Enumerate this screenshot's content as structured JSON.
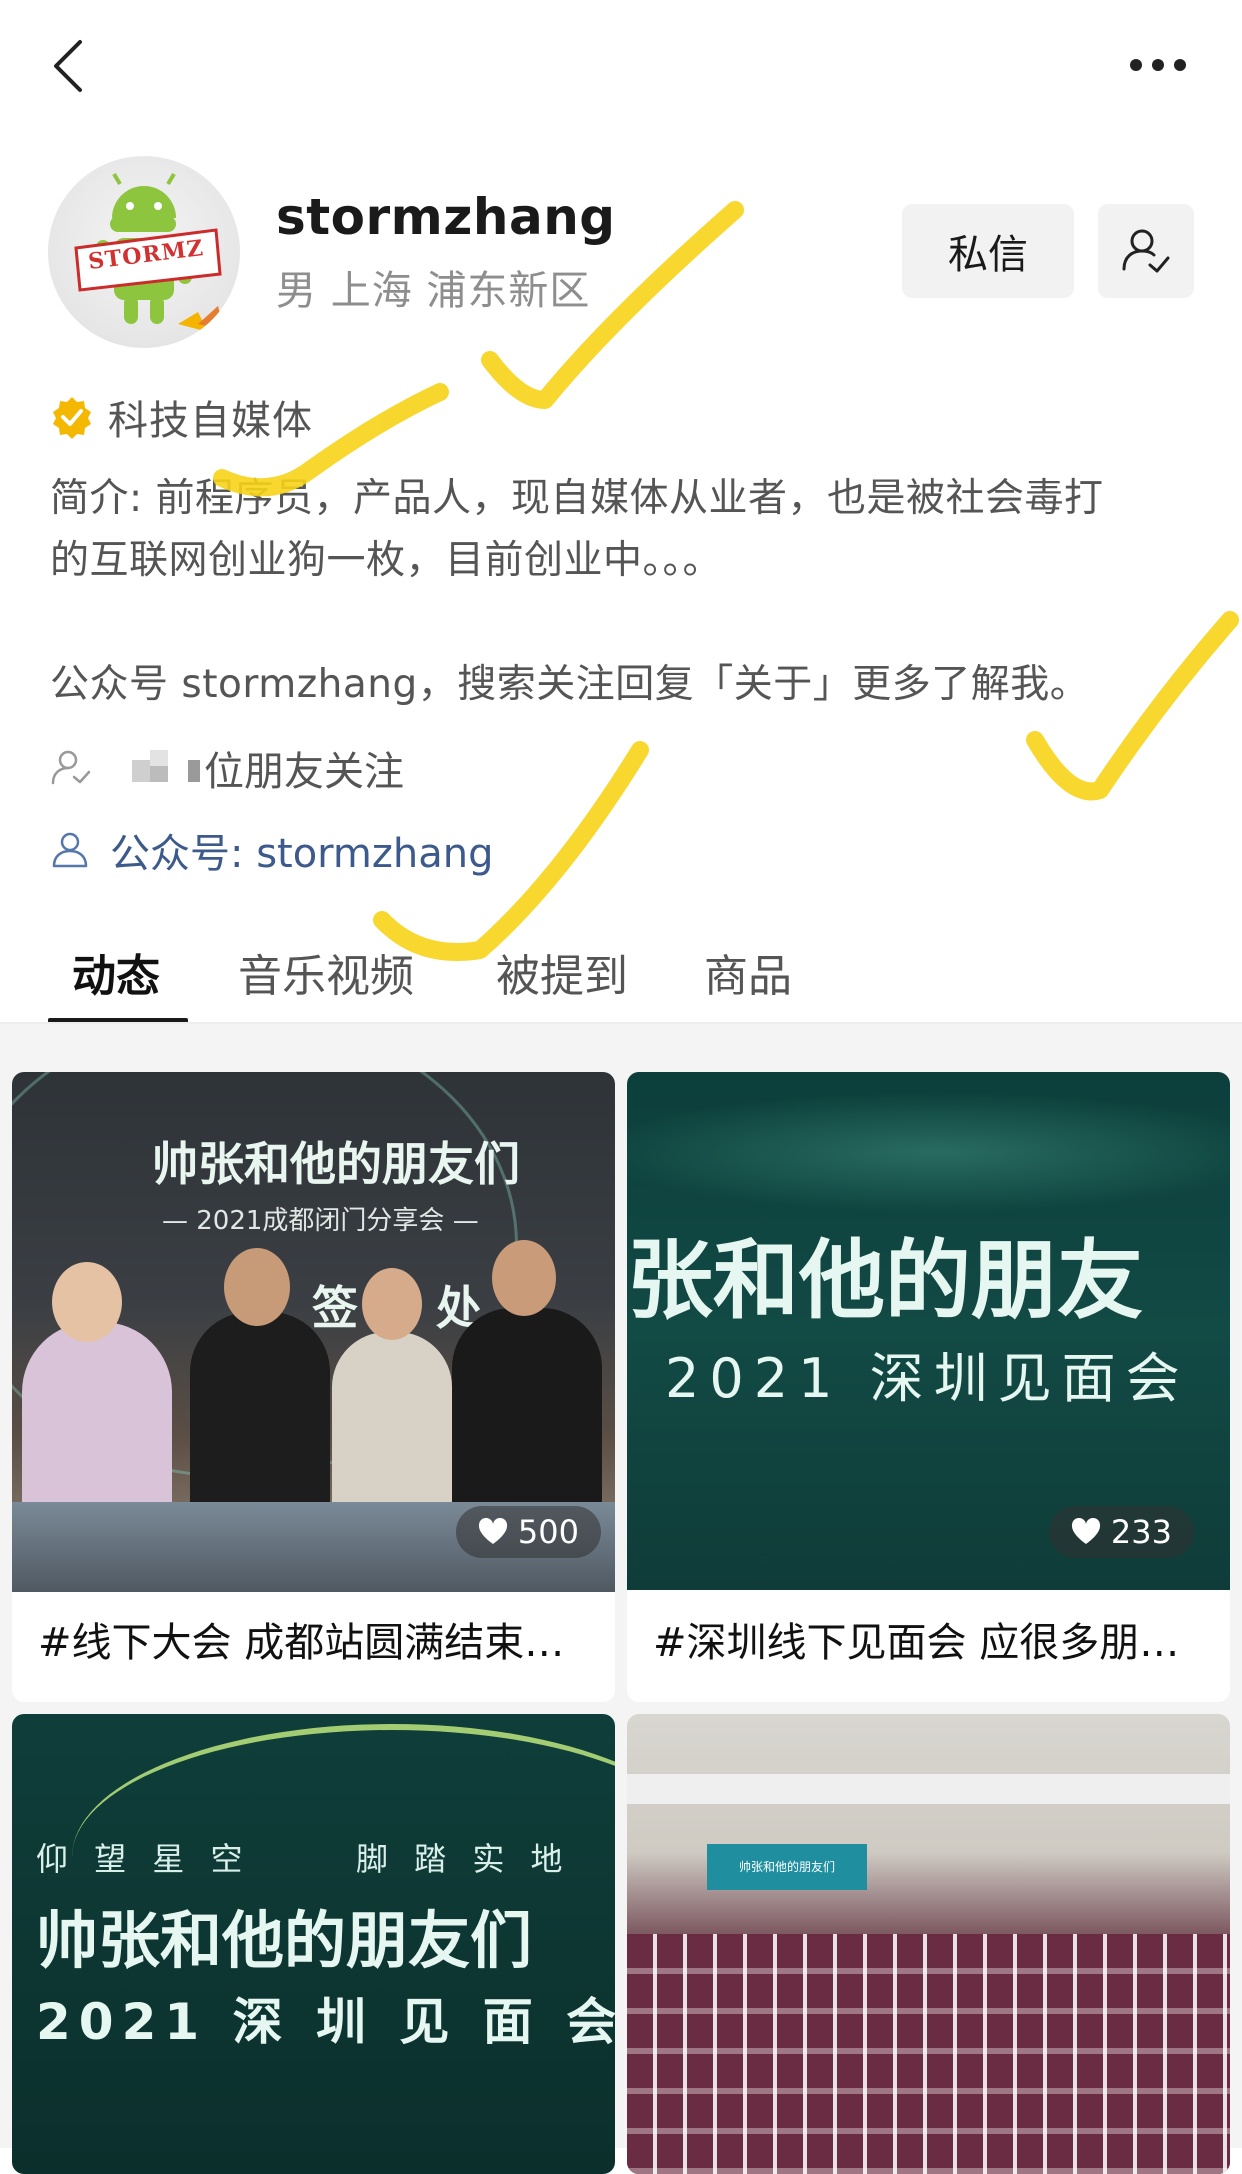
{
  "profile": {
    "nickname": "stormzhang",
    "location": "男 上海 浦东新区",
    "avatar_text": "STORMZ",
    "message_button": "私信",
    "verify_label": "科技自媒体",
    "bio_line1": "简介: 前程序员，产品人，现自媒体从业者，也是被社会毒打",
    "bio_line2": "的互联网创业狗一枚，目前创业中。。。",
    "bio_line3": "公众号 stormzhang，搜索关注回复「关于」更多了解我。",
    "friends_following": "位朋友关注",
    "official_account": "公众号: stormzhang"
  },
  "tabs": [
    {
      "label": "动态",
      "active": true
    },
    {
      "label": "音乐视频",
      "active": false
    },
    {
      "label": "被提到",
      "active": false
    },
    {
      "label": "商品",
      "active": false
    }
  ],
  "posts": [
    {
      "caption": "#线下大会 成都站圆满结束…",
      "likes": "500",
      "img_title": "帅张和他的朋友们",
      "img_subtitle": "— 2021成都闭门分享会 —",
      "img_sign": "签 到 处"
    },
    {
      "caption": "#深圳线下见面会 应很多朋…",
      "likes": "233",
      "img_title": "张和他的朋友",
      "img_subtitle": "2021 深圳见面会"
    },
    {
      "img_top_left": "仰 望 星 空",
      "img_top_right": "脚 踏 实 地",
      "img_title": "帅张和他的朋友们",
      "img_subtitle": "2021 深 圳 见 面 会"
    },
    {
      "img_screen_text": "帅张和他的朋友们"
    }
  ],
  "colors": {
    "accent_verify": "#f5b800",
    "official_link": "#3d5a8c",
    "annotation_marks": "#f7d317"
  },
  "icons": [
    "back-arrow-icon",
    "more-dots-icon",
    "follow-user-icon",
    "verified-badge-icon",
    "friends-icon",
    "official-account-icon",
    "heart-icon"
  ]
}
